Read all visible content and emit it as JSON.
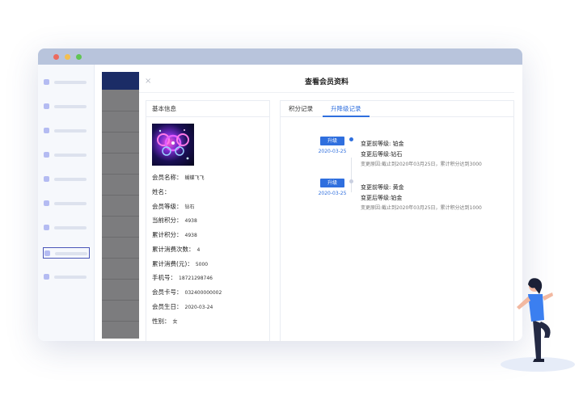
{
  "drawer": {
    "close_symbol": "×",
    "title": "查看会员资料"
  },
  "basic_info": {
    "heading": "基本信息",
    "fields": [
      {
        "label": "会员名称：",
        "value": "蝴蝶飞飞"
      },
      {
        "label": "姓名：",
        "value": ""
      },
      {
        "label": "会员等级：",
        "value": "钻石"
      },
      {
        "label": "当前积分：",
        "value": "4938"
      },
      {
        "label": "累计积分：",
        "value": "4938"
      },
      {
        "label": "累计消费次数：",
        "value": "4"
      },
      {
        "label": "累计消费(元)：",
        "value": "5000"
      },
      {
        "label": "手机号：",
        "value": "18721298746"
      },
      {
        "label": "会员卡号：",
        "value": "032400000002"
      },
      {
        "label": "会员生日：",
        "value": "2020-03-24"
      },
      {
        "label": "性别：",
        "value": "女"
      }
    ]
  },
  "tabs": [
    {
      "label": "积分记录",
      "active": false
    },
    {
      "label": "升降级记录",
      "active": true
    }
  ],
  "timeline": [
    {
      "badge": "升级",
      "date": "2020-03-25",
      "before": "变更前等级: 铂金",
      "after": "变更后等级:钻石",
      "reason": "变更原因:截止到2020年03月25日，累计积分达到3000"
    },
    {
      "badge": "升级",
      "date": "2020-03-25",
      "before": "变更前等级: 黄金",
      "after": "变更后等级:铂金",
      "reason": "变更原因:截止到2020年03月25日，累计积分达到1000"
    }
  ],
  "colors": {
    "accent": "#2f6fde",
    "titlebar": "#b8c4dc",
    "sidebar_marker": "#b4bbf2",
    "dimmed_list": "#7c7c7e",
    "dimmed_header": "#1b2c66"
  }
}
